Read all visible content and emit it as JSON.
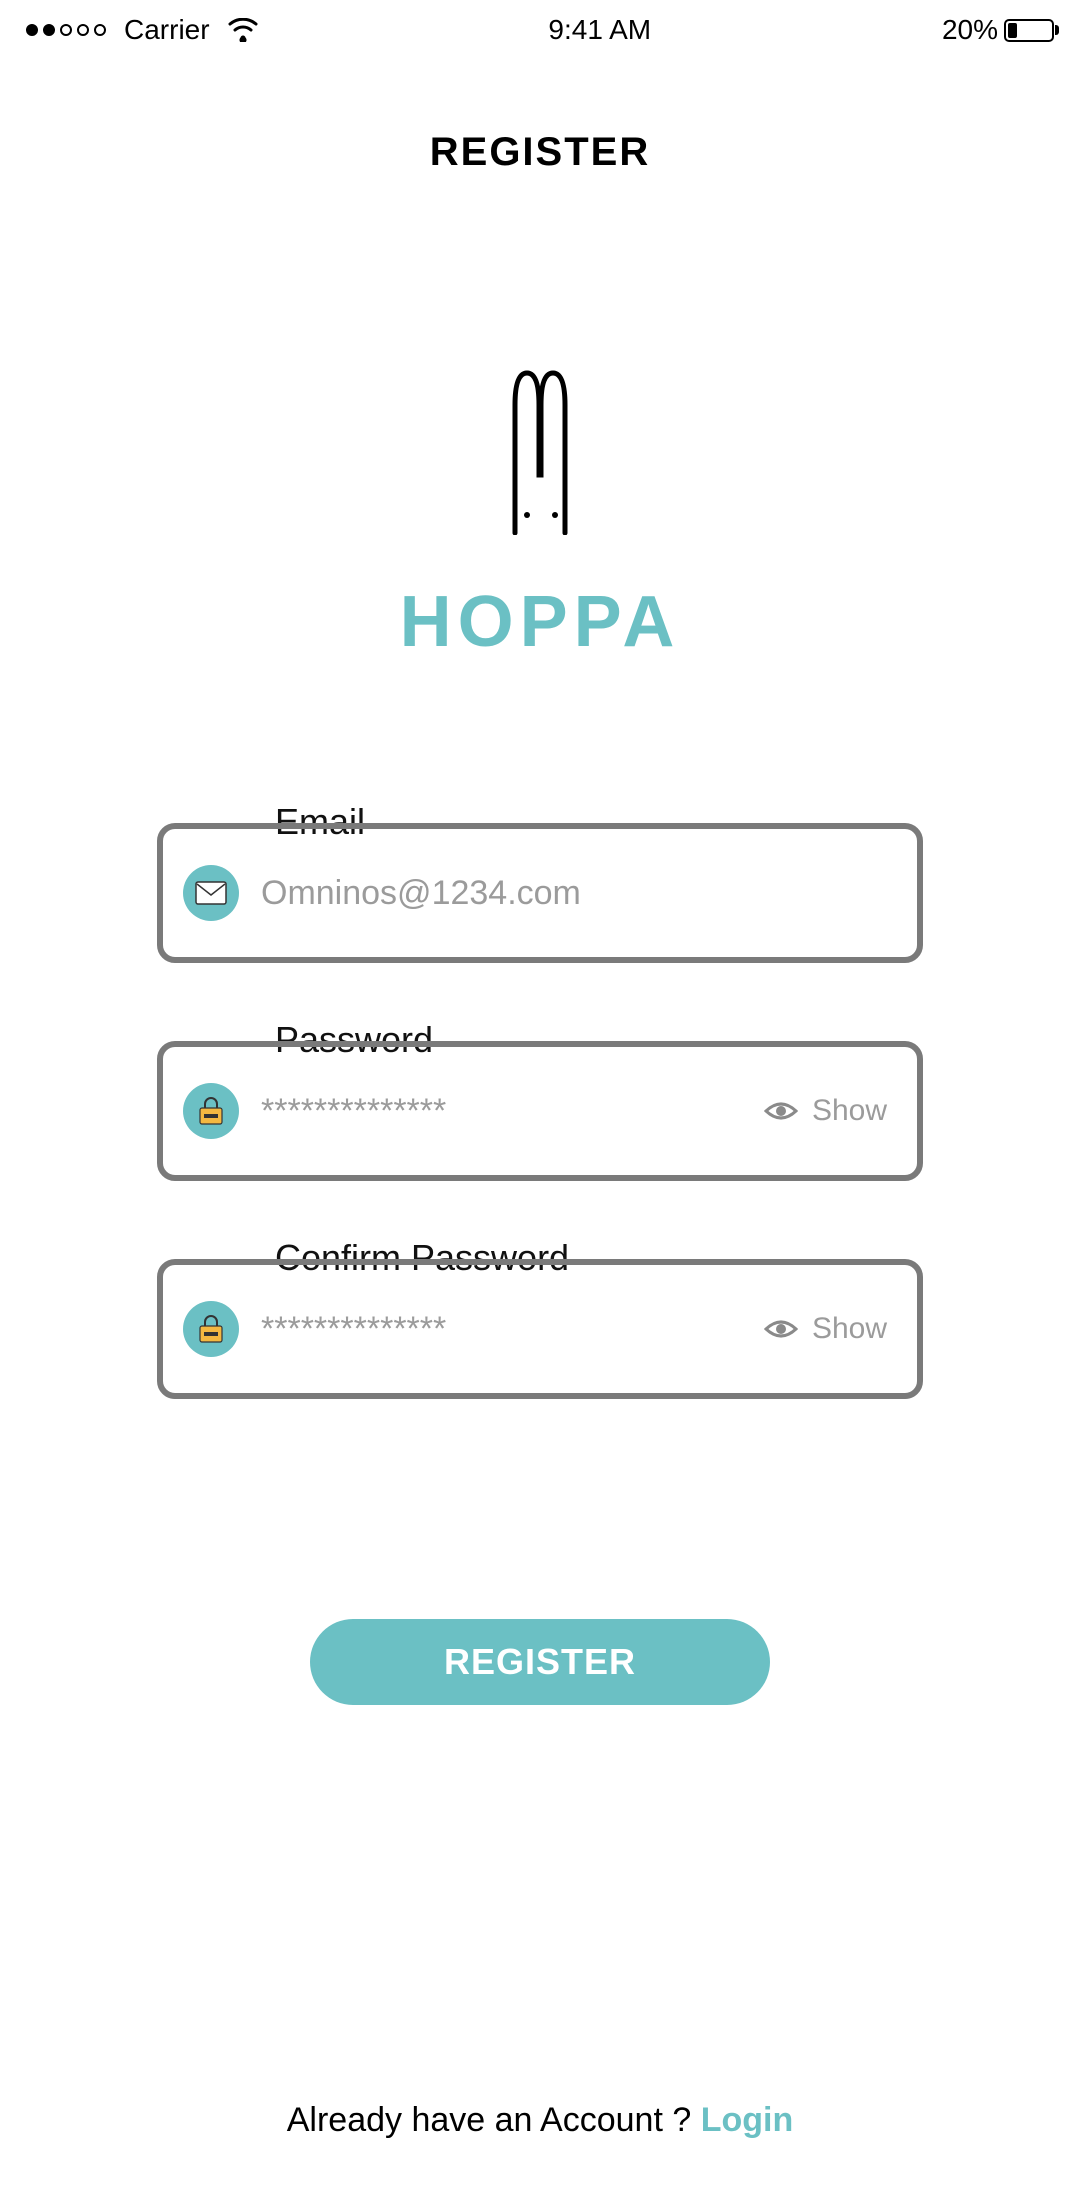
{
  "status_bar": {
    "carrier": "Carrier",
    "time": "9:41 AM",
    "battery_pct": "20%"
  },
  "page": {
    "title": "REGISTER"
  },
  "brand": {
    "name": "HOPPA"
  },
  "form": {
    "email": {
      "label": "Email",
      "placeholder": "Omninos@1234.com",
      "value": ""
    },
    "password": {
      "label": "Password",
      "placeholder": "**************",
      "value": "",
      "show_label": "Show"
    },
    "confirm": {
      "label": "Confirm Password",
      "placeholder": "**************",
      "value": "",
      "show_label": "Show"
    }
  },
  "actions": {
    "register": "REGISTER"
  },
  "footer": {
    "prompt": "Already have an Account ? ",
    "login": "Login"
  },
  "colors": {
    "accent": "#6bc0c4"
  }
}
